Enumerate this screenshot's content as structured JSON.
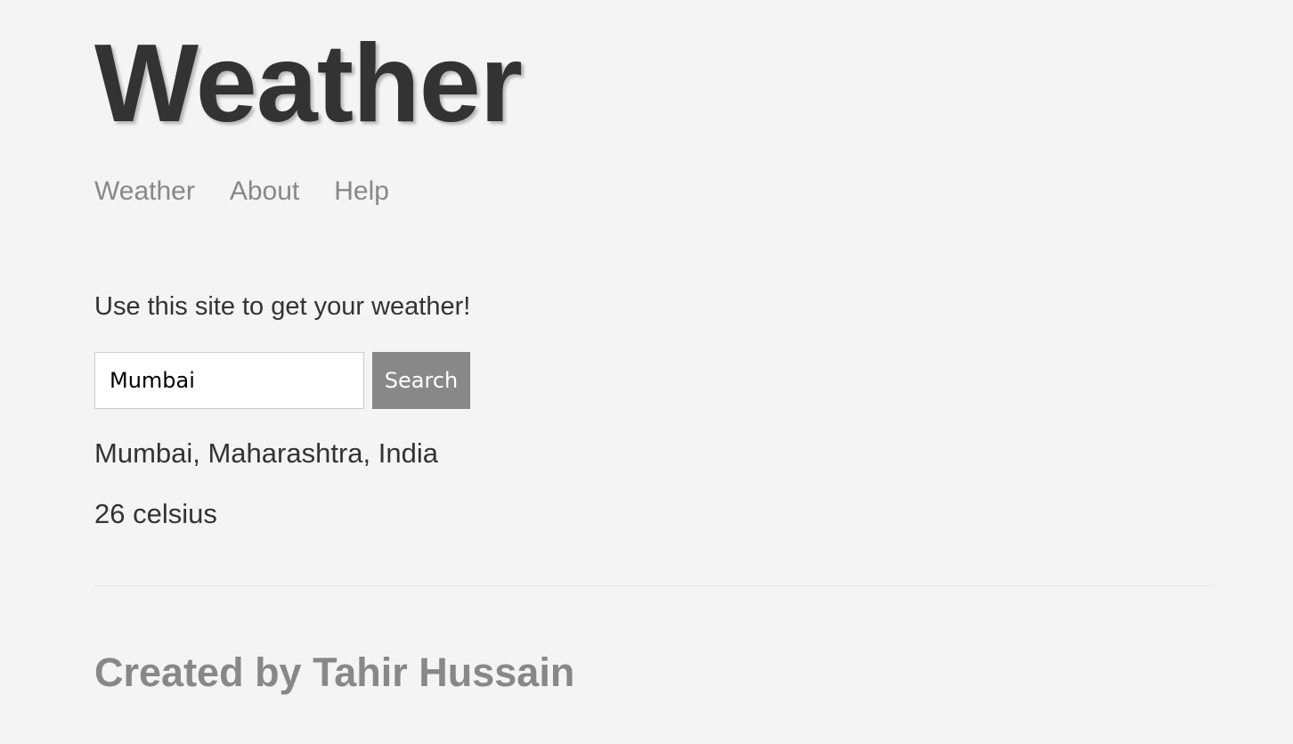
{
  "header": {
    "title": "Weather"
  },
  "nav": {
    "items": [
      {
        "label": "Weather"
      },
      {
        "label": "About"
      },
      {
        "label": "Help"
      }
    ]
  },
  "main": {
    "intro": "Use this site to get your weather!",
    "search": {
      "value": "Mumbai",
      "button_label": "Search"
    },
    "result": {
      "location": "Mumbai, Maharashtra, India",
      "temperature": "26 celsius"
    }
  },
  "footer": {
    "credit": "Created by Tahir Hussain"
  },
  "colors": {
    "background": "#f4f4f4",
    "text": "#333333",
    "muted": "#888888",
    "button_bg": "#888888",
    "button_text": "#ffffff"
  }
}
